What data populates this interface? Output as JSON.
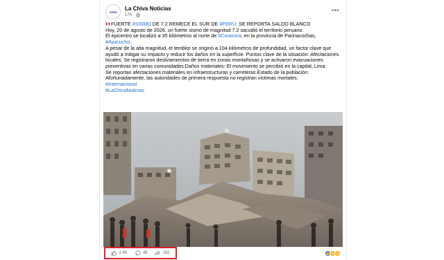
{
  "post": {
    "page_name": "La Chiva Noticias",
    "avatar_text": "CHIVA",
    "time": "17h",
    "separator": "·",
    "more_menu": "•••",
    "headline_pre": "FUERTE ",
    "headline_tag1": "#SISMO",
    "headline_mid": " DE 7.2 REMECE EL SUR DE ",
    "headline_tag2": "#PERÚ",
    "headline_post": ": SE REPORTA SALDO BLANCO",
    "line1": "Hoy, 20 de agosto de 2026, un fuerte sismo de magnitud 7.2 sacudió el territorio peruano.",
    "line2_pre": "El epicentro se localizó a 35 kilómetros al norte de ",
    "line2_tag": "#Coracora",
    "line2_post": ", en la provincia de Parinacochas,",
    "line3_tag": "#Ayacucho",
    "line3_post": ".",
    "para2": "A pesar de la alta magnitud, el temblor se originó a 104 kilómetros de profundidad, un factor clave que ayudó a mitigar su impacto y reducir los daños en la superficie. Puntos clave de la situación: Afectaciones locales: Se registraron deslizamientos de tierra en zonas montañosas y se activaron evacuaciones preventivas en varias comunidades.Daños materiales: El movimiento se percibió en la capital, Lima.",
    "para3": "Se reportan afectaciones materiales en infraestructuras y carreteras.Estado de la población: Afortunadamente, las autoridades de primera respuesta no registran víctimas mortales.",
    "tag_a": "#Internacional",
    "tag_b": "#LaChivaNoticias"
  },
  "actions": {
    "likes": "2.4K",
    "comments": "48",
    "shares": "162"
  },
  "icons": {
    "globe": "globe-icon",
    "like": "thumbs-up-icon",
    "comment": "comment-icon",
    "share": "share-icon"
  },
  "colors": {
    "hashtag": "#216fdb",
    "highlight_border": "#e0202a",
    "like_blue": "#1877f2",
    "haha_yellow": "#f7b125"
  }
}
